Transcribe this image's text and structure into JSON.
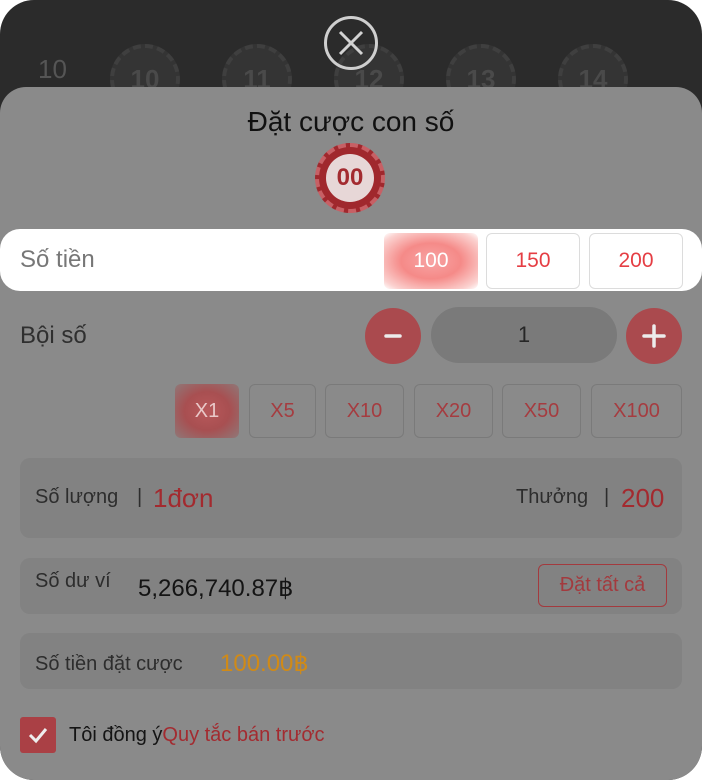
{
  "background": {
    "row_label": "10",
    "balls": [
      "10",
      "11",
      "12",
      "13",
      "14"
    ]
  },
  "dialog": {
    "title": "Đặt cược con số",
    "selected_number": "00"
  },
  "amount": {
    "label": "Số tiền",
    "options": [
      "100",
      "150",
      "200"
    ],
    "selected": "100"
  },
  "multiplier": {
    "label": "Bội số",
    "minus_label": "-",
    "plus_label": "+",
    "value": "1",
    "options": [
      "X1",
      "X5",
      "X10",
      "X20",
      "X50",
      "X100"
    ],
    "selected": "X1"
  },
  "summary": {
    "qty_label": "Số lượng",
    "qty_value": "1đơn",
    "separator": "|",
    "reward_label": "Thưởng",
    "reward_value": "200"
  },
  "balance": {
    "label": "Số dư ví",
    "value": "5,266,740.87฿",
    "all_in_label": "Đặt tất cả"
  },
  "bet": {
    "label": "Số tiền đặt cược",
    "value": "100.00฿"
  },
  "agreement": {
    "checked": true,
    "text": "Tôi đồng ý",
    "link": "Quy tắc bán trước"
  },
  "colors": {
    "accent": "#e53e44",
    "dim_accent": "#a32b30",
    "bet_value": "#d08a17"
  }
}
